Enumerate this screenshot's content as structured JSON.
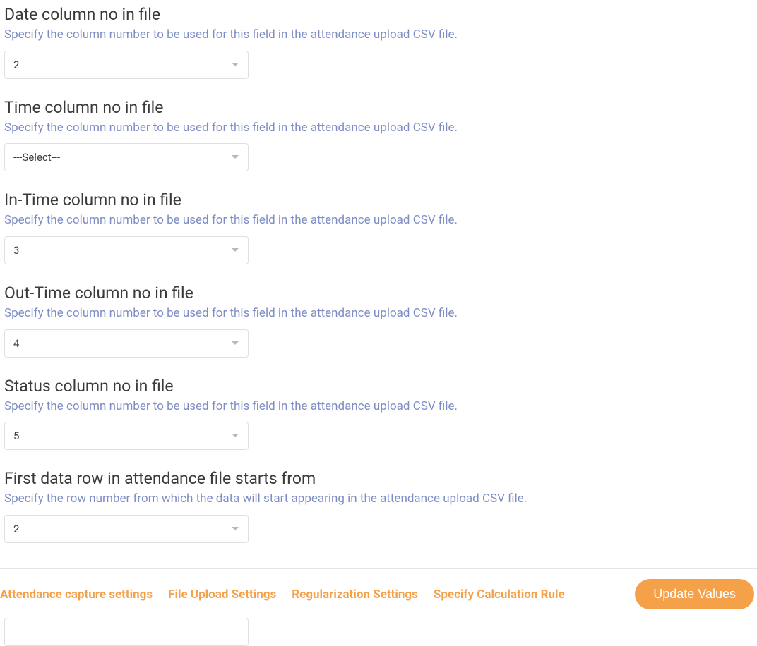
{
  "fields": {
    "date_col": {
      "label": "Date column no in file",
      "desc": "Specify the column number to be used for this field in the attendance upload CSV file.",
      "value": "2"
    },
    "time_col": {
      "label": "Time column no in file",
      "desc": "Specify the column number to be used for this field in the attendance upload CSV file.",
      "value": "---Select---"
    },
    "in_time": {
      "label": "In-Time column no in file",
      "desc": "Specify the column number to be used for this field in the attendance upload CSV file.",
      "value": "3"
    },
    "out_time": {
      "label": "Out-Time column no in file",
      "desc": "Specify the column number to be used for this field in the attendance upload CSV file.",
      "value": "4"
    },
    "status_col": {
      "label": "Status column no in file",
      "desc": "Specify the column number to be used for this field in the attendance upload CSV file.",
      "value": "5"
    },
    "first_row": {
      "label": "First data row in attendance file starts from",
      "desc": "Specify the row number from which the data will start appearing in the attendance upload CSV file.",
      "value": "2"
    }
  },
  "footer": {
    "tabs": {
      "capture": "Attendance capture settings",
      "upload": "File Upload Settings",
      "regular": "Regularization Settings",
      "calc": "Specify Calculation Rule"
    },
    "update_label": "Update Values"
  },
  "extra_input": {
    "value": ""
  }
}
